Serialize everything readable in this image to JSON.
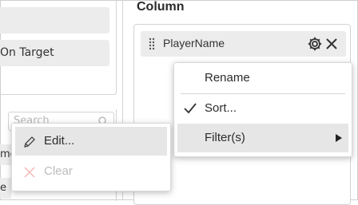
{
  "left_panel": {
    "chip1_label": "",
    "chip2_label": "On Target"
  },
  "lower_panel": {
    "search_placeholder": "Search",
    "row_fragments": [
      "me",
      "e"
    ]
  },
  "column_section": {
    "title": "Column",
    "field": {
      "label": "PlayerName"
    }
  },
  "field_menu": {
    "items": [
      {
        "label": "Rename"
      },
      {
        "label": "Sort..."
      },
      {
        "label": "Filter(s)"
      }
    ]
  },
  "filter_menu": {
    "items": [
      {
        "label": "Edit..."
      },
      {
        "label": "Clear"
      }
    ]
  },
  "icons": {
    "grip": "drag-grip-icon",
    "gear": "gear-icon",
    "close": "close-icon",
    "check": "check-icon",
    "submenu": "caret-right-icon",
    "edit": "pencil-icon",
    "clear": "x-icon",
    "search": "search-icon"
  },
  "colors": {
    "chip_bg": "#ececec",
    "border": "#d3d3d3",
    "menu_hover": "#e6e6e6",
    "disabled_text": "#bdbdbd"
  }
}
